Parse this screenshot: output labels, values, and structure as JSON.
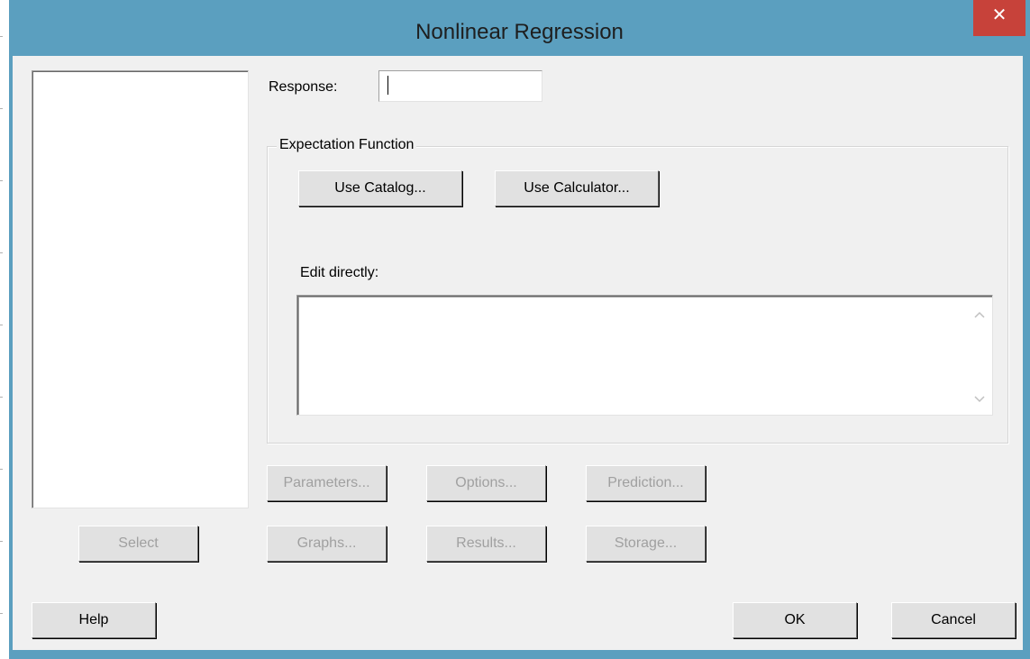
{
  "window": {
    "title": "Nonlinear Regression",
    "close_label": "✕"
  },
  "response": {
    "label": "Response:",
    "value": ""
  },
  "expectation": {
    "group_title": "Expectation Function",
    "use_catalog_label": "Use Catalog...",
    "use_calculator_label": "Use Calculator...",
    "edit_label": "Edit directly:",
    "edit_value": ""
  },
  "buttons": {
    "parameters": "Parameters...",
    "options": "Options...",
    "prediction": "Prediction...",
    "select": "Select",
    "graphs": "Graphs...",
    "results": "Results...",
    "storage": "Storage...",
    "help": "Help",
    "ok": "OK",
    "cancel": "Cancel"
  },
  "colors": {
    "titlebar": "#5b9fbf",
    "close": "#c7423a",
    "dialog_bg": "#f0f0f0",
    "disabled_text": "#a0a0a0"
  }
}
